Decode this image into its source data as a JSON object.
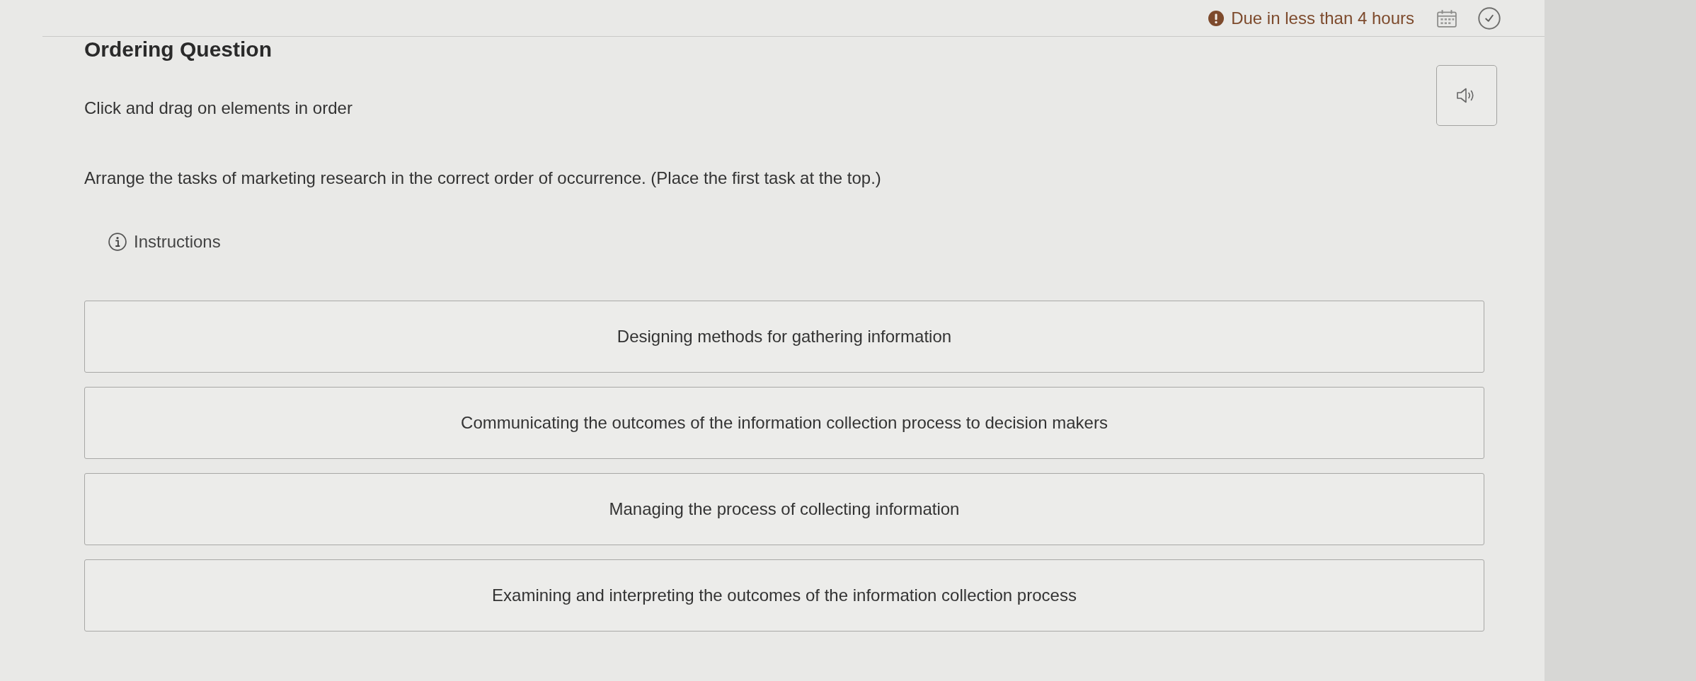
{
  "header": {
    "due": "Due in less than 4 hours"
  },
  "title": "Ordering Question",
  "prompt": "Click and drag on elements in order",
  "question": "Arrange the tasks of marketing research in the correct order of occurrence. (Place the first task at the top.)",
  "instructions": {
    "label": "Instructions"
  },
  "items": [
    {
      "text": "Designing methods for gathering information"
    },
    {
      "text": "Communicating the outcomes of the information collection process to decision makers"
    },
    {
      "text": "Managing the process of collecting information"
    },
    {
      "text": "Examining and interpreting the outcomes of the information collection process"
    }
  ]
}
